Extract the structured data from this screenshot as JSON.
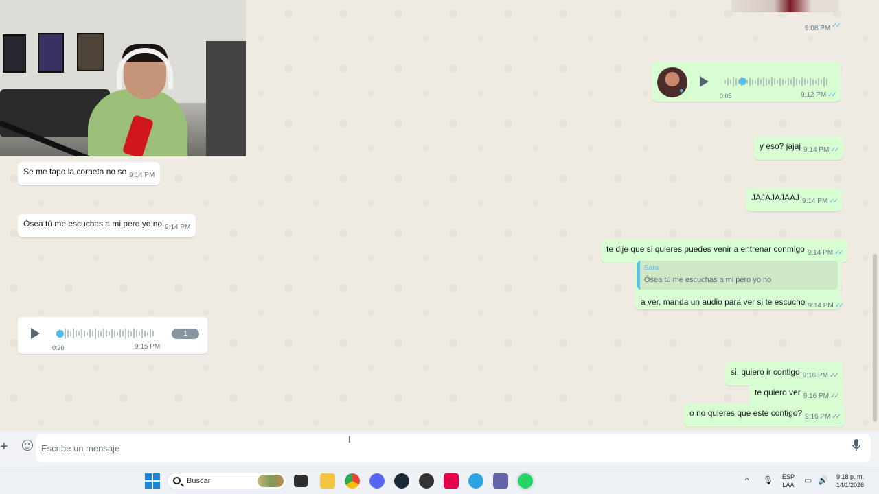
{
  "colors": {
    "outgoing_bubble": "#d9fdd3",
    "incoming_bubble": "#ffffff",
    "read_ticks": "#53bdeb",
    "chat_background": "#efeae2"
  },
  "messages_incoming": [
    {
      "text": "Se me tapo la corneta no se",
      "time": "9:14 PM"
    },
    {
      "text": "Ósea tú me escuchas a mi pero yo no",
      "time": "9:14 PM"
    }
  ],
  "voice_in": {
    "duration": "0:20",
    "time": "9:15 PM",
    "speed": "1"
  },
  "voice_out": {
    "duration": "0:05",
    "time": "9:12 PM"
  },
  "top_image": {
    "time": "9:08 PM"
  },
  "messages_outgoing": [
    {
      "text": "y eso? jajaj",
      "time": "9:14 PM",
      "status": "read"
    },
    {
      "text": "JAJAJAJAAJ",
      "time": "9:14 PM",
      "status": "read"
    },
    {
      "text": "te dije que si quieres puedes venir a entrenar conmigo",
      "time": "9:14 PM",
      "status": "read"
    },
    {
      "text": "a ver, manda un audio para ver si te escucho",
      "time": "9:14 PM",
      "status": "read"
    },
    {
      "text": "si, quiero ir contigo",
      "time": "9:16 PM",
      "status": "delivered"
    },
    {
      "text": "te quiero ver",
      "time": "9:16 PM",
      "status": "delivered"
    },
    {
      "text": "o no quieres que este contigo?",
      "time": "9:16 PM",
      "status": "delivered"
    }
  ],
  "reply_quote": {
    "name": "Sara",
    "text": "Ósea tú me escuchas a mi pero yo no"
  },
  "composer": {
    "placeholder": "Escribe un mensaje"
  },
  "taskbar": {
    "search_label": "Buscar",
    "lang_line1": "ESP",
    "lang_line2": "LAA",
    "time": "9:18 p. m.",
    "date": "14/1/2026"
  }
}
